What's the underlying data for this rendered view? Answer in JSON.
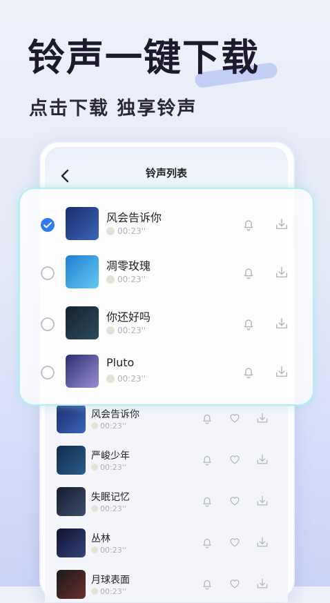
{
  "headline": "铃声一键下载",
  "subline": "点击下载 独享铃声",
  "screen": {
    "title": "铃声列表"
  },
  "panel_items": [
    {
      "title": "风会告诉你",
      "duration": "00:23''",
      "selected": true,
      "cover_colors": [
        "#1a2c6e",
        "#3b66b8"
      ]
    },
    {
      "title": "凋零玫瑰",
      "duration": "00:23''",
      "selected": false,
      "cover_colors": [
        "#1e7fd0",
        "#63c9f2"
      ]
    },
    {
      "title": "你还好吗",
      "duration": "00:23''",
      "selected": false,
      "cover_colors": [
        "#16222f",
        "#2c4a5e"
      ]
    },
    {
      "title": "Pluto",
      "duration": "00:23''",
      "selected": false,
      "cover_colors": [
        "#2b2f6e",
        "#9a8ed8"
      ]
    }
  ],
  "list_items": [
    {
      "title": "风会告诉你",
      "duration": "00:23''",
      "cover_colors": [
        "#1a2c6e",
        "#3b66b8"
      ]
    },
    {
      "title": "严峻少年",
      "duration": "00:23''",
      "cover_colors": [
        "#0f2a4a",
        "#2a5f8a"
      ]
    },
    {
      "title": "失眠记忆",
      "duration": "00:23''",
      "cover_colors": [
        "#141c2c",
        "#3d4d6b"
      ]
    },
    {
      "title": "丛林",
      "duration": "00:23''",
      "cover_colors": [
        "#0d1230",
        "#35437a"
      ]
    },
    {
      "title": "月球表面",
      "duration": "00:23''",
      "cover_colors": [
        "#1a1a1a",
        "#6b2e2e"
      ]
    }
  ],
  "colors": {
    "accent": "#2f7bf0",
    "panel_border": "#b8ecf2"
  }
}
